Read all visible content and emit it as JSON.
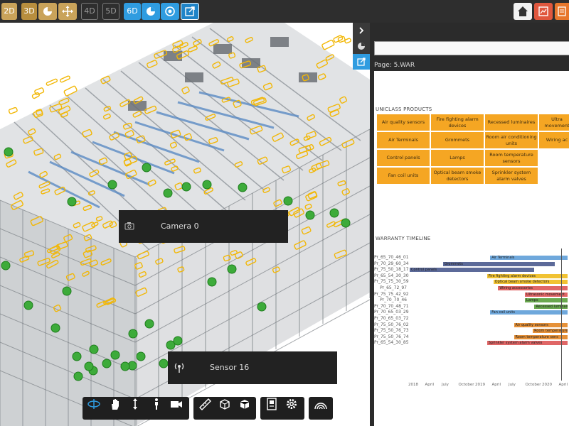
{
  "toolbar": {
    "left": [
      {
        "label": "2D",
        "style": "gold"
      },
      {
        "label": "3D",
        "style": "gold-active"
      },
      {
        "icon": "pie-chart-icon",
        "style": "gold"
      },
      {
        "icon": "move-arrows-icon",
        "style": "gold"
      },
      {
        "label": "4D",
        "style": "dim"
      },
      {
        "label": "5D",
        "style": "dim"
      },
      {
        "label": "6D",
        "style": "blue"
      },
      {
        "icon": "pie-chart-icon",
        "style": "blue"
      },
      {
        "icon": "target-icon",
        "style": "blue"
      },
      {
        "icon": "external-link-icon",
        "style": "blue-selected"
      }
    ],
    "right": [
      {
        "icon": "home-icon",
        "style": "white"
      },
      {
        "icon": "report-icon",
        "style": "red"
      },
      {
        "icon": "document-icon",
        "style": "orange"
      }
    ]
  },
  "viewport": {
    "camera_label": "Camera 0",
    "sensor_label": "Sensor 16",
    "bottom_tools": [
      "orbit-icon",
      "pan-hand-icon",
      "vertical-move-icon",
      "walk-person-icon",
      "camera-icon",
      "measure-ruler-icon",
      "section-box-icon",
      "model-box-icon",
      "properties-icon",
      "settings-gear-icon",
      "sensor-rainbow-icon"
    ]
  },
  "side_buttons": [
    "chevron-right-icon",
    "pie-chart-icon",
    "external-link-icon"
  ],
  "panel": {
    "page_label": "Page: 5.WAR",
    "uniclass_title": "UNICLASS PRODUCTS",
    "uniclass_cells": [
      [
        "Air quality sensors",
        "Fire fighting alarm devices",
        "Recessed luminaires",
        "Ultra movement"
      ],
      [
        "Air Terminals",
        "Grommets",
        "Room air conditioning units",
        "Wiring ac"
      ],
      [
        "Control panels",
        "Lamps",
        "Room temperature sensors",
        ""
      ],
      [
        "Fan coil units",
        "Optical beam smoke detectors",
        "Sprinkler system alarm valves",
        ""
      ]
    ],
    "warranty_title": "WARRANTY TIMELINE",
    "timeline_rows": [
      {
        "code": "Pr_65_70_46_01",
        "bar": "Air Terminals",
        "color": "#6fa8dc",
        "start": 0.51,
        "end": 1.0
      },
      {
        "code": "Pr_70_29_60_34",
        "bar": "Grommets",
        "color": "#5c6a99",
        "start": 0.21,
        "end": 0.92
      },
      {
        "code": "Pr_75_50_18_17",
        "bar": "Control panels",
        "color": "#5c6a99",
        "start": 0.0,
        "end": 0.79
      },
      {
        "code": "Pr_65_54_30_30",
        "bar": "Fire fighting alarm devices",
        "color": "#f1c232",
        "start": 0.49,
        "end": 1.0
      },
      {
        "code": "Pr_75_75_30_59",
        "bar": "Optical beam smoke detectors",
        "color": "#f1c232",
        "start": 0.53,
        "end": 1.0
      },
      {
        "code": "Pr_65_72_97",
        "bar": "Wiring accessories",
        "color": "#e06666",
        "start": 0.56,
        "end": 1.0
      },
      {
        "code": "Pr_75_75_42_92",
        "bar": "Ultrasonic movement",
        "color": "#e06666",
        "start": 0.73,
        "end": 1.0
      },
      {
        "code": "Pr_70_70_46",
        "bar": "Lamps",
        "color": "#6aa84f",
        "start": 0.73,
        "end": 1.0
      },
      {
        "code": "Pr_70_70_48_71",
        "bar": "Recessed luminaires",
        "color": "#6aa84f",
        "start": 0.79,
        "end": 1.0
      },
      {
        "code": "Pr_70_65_03_29",
        "bar": "Fan coil units",
        "color": "#6fa8dc",
        "start": 0.51,
        "end": 1.0
      },
      {
        "code": "Pr_70_65_03_72",
        "bar": "",
        "color": "#6fa8dc",
        "start": 0.51,
        "end": 0.51
      },
      {
        "code": "Pr_75_50_76_02",
        "bar": "Air quality sensors",
        "color": "#e69138",
        "start": 0.66,
        "end": 1.0
      },
      {
        "code": "Pr_75_50_76_73",
        "bar": "Room temperature sens",
        "color": "#e69138",
        "start": 0.78,
        "end": 1.0
      },
      {
        "code": "Pr_75_50_76_74",
        "bar": "Room temperature sens",
        "color": "#e69138",
        "start": 0.66,
        "end": 1.0
      },
      {
        "code": "Pr_65_54_30_85",
        "bar": "Sprinkler system alarm valves",
        "color": "#e06666",
        "start": 0.49,
        "end": 1.0
      }
    ],
    "timeline_ticks": [
      "2018",
      "April",
      "July",
      "October",
      "2019",
      "April",
      "July",
      "October",
      "2020",
      "April"
    ]
  }
}
